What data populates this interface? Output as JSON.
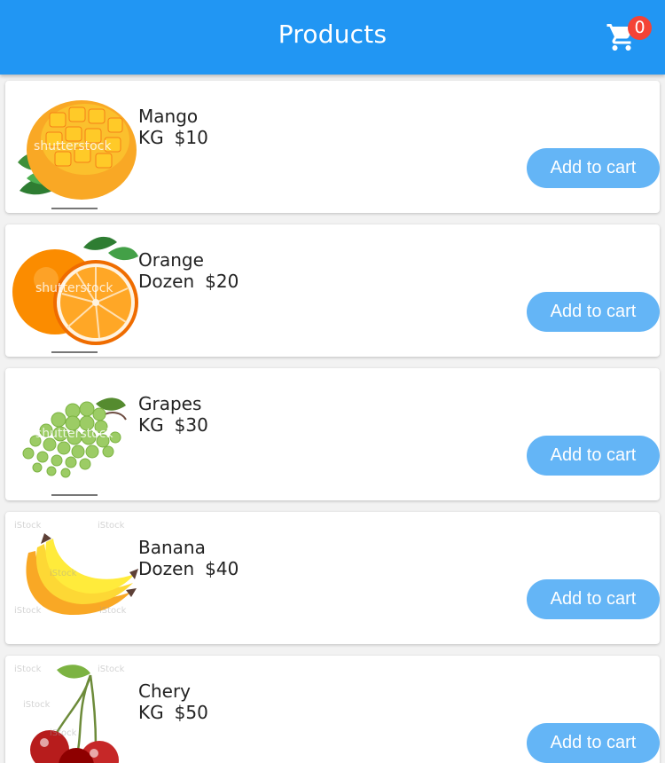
{
  "app_bar": {
    "title": "Products",
    "cart_icon": "shopping-cart-icon",
    "cart_count": "0",
    "color": "#2196f3",
    "badge_color": "#f44336"
  },
  "products": [
    {
      "name": "Mango",
      "unit": "KG",
      "price": "$10",
      "image_icon": "mango-image",
      "button_label": "Add to cart"
    },
    {
      "name": "Orange",
      "unit": "Dozen",
      "price": "$20",
      "image_icon": "orange-image",
      "button_label": "Add to cart"
    },
    {
      "name": "Grapes",
      "unit": "KG",
      "price": "$30",
      "image_icon": "grapes-image",
      "button_label": "Add to cart"
    },
    {
      "name": "Banana",
      "unit": "Dozen",
      "price": "$40",
      "image_icon": "banana-image",
      "button_label": "Add to cart"
    },
    {
      "name": "Chery",
      "unit": "KG",
      "price": "$50",
      "image_icon": "cherry-image",
      "button_label": "Add to cart"
    }
  ],
  "button_color": "#64b5f6"
}
